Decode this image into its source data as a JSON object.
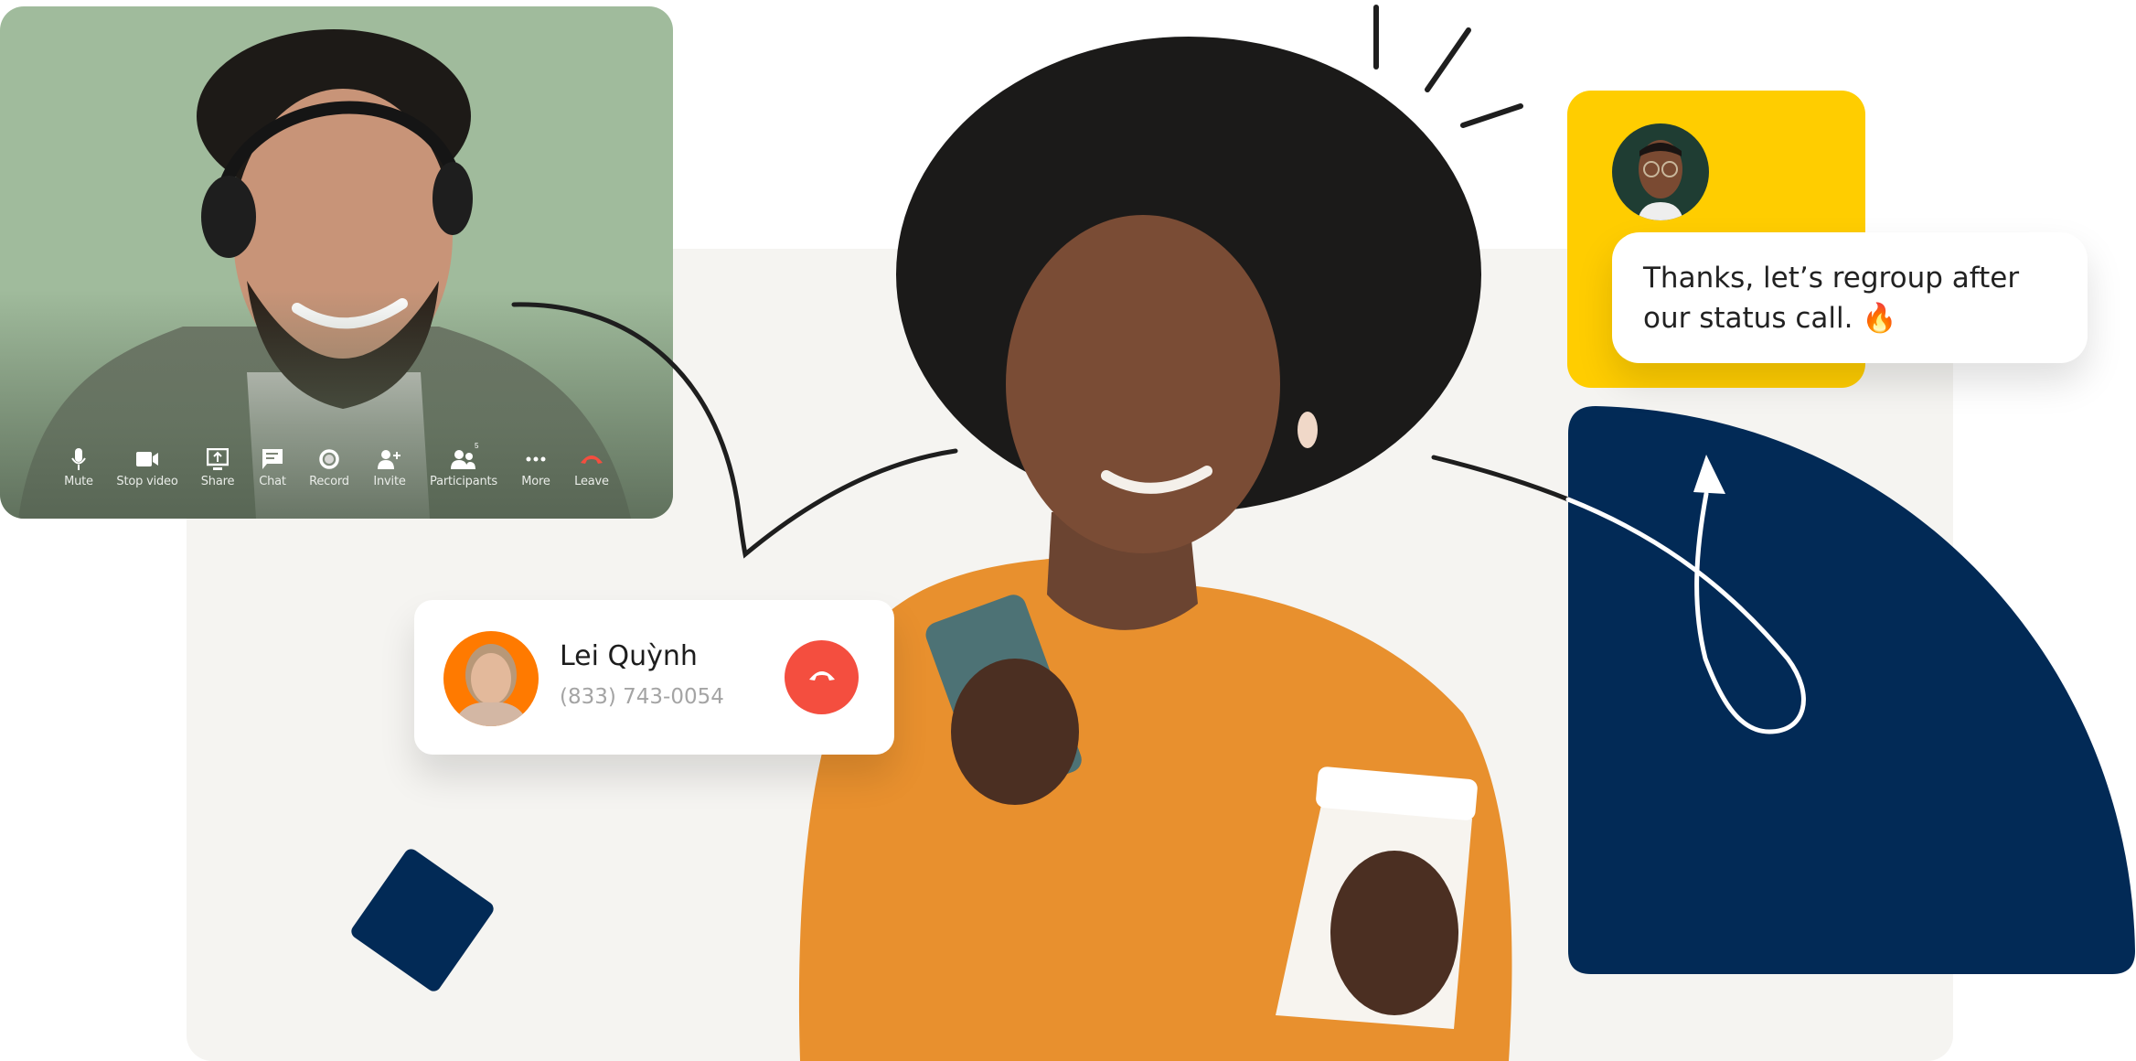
{
  "video_call": {
    "participant_count_badge": "5",
    "toolbar": [
      {
        "id": "mute",
        "label": "Mute",
        "icon": "microphone-icon"
      },
      {
        "id": "stop-video",
        "label": "Stop video",
        "icon": "video-camera-icon"
      },
      {
        "id": "share",
        "label": "Share",
        "icon": "share-screen-icon"
      },
      {
        "id": "chat",
        "label": "Chat",
        "icon": "chat-bubble-icon"
      },
      {
        "id": "record",
        "label": "Record",
        "icon": "record-icon"
      },
      {
        "id": "invite",
        "label": "Invite",
        "icon": "add-person-icon"
      },
      {
        "id": "participants",
        "label": "Participants",
        "icon": "participants-icon"
      },
      {
        "id": "more",
        "label": "More",
        "icon": "more-dots-icon"
      },
      {
        "id": "leave",
        "label": "Leave",
        "icon": "hang-up-icon"
      }
    ]
  },
  "call_card": {
    "caller_name": "Lei Quỳnh",
    "caller_phone": "(833) 743-0054",
    "end_call_icon": "hang-up-icon"
  },
  "message_card": {
    "text": "Thanks, let’s regroup after our status call. 🔥"
  },
  "colors": {
    "panel_beige": "#f5f4f1",
    "navy": "#022a56",
    "yellow": "#ffcd00",
    "end_call_red": "#f44e3f",
    "avatar_orange": "#ff7a00",
    "video_bg_green": "#a0bb9c",
    "sweater_orange": "#e8902e"
  }
}
